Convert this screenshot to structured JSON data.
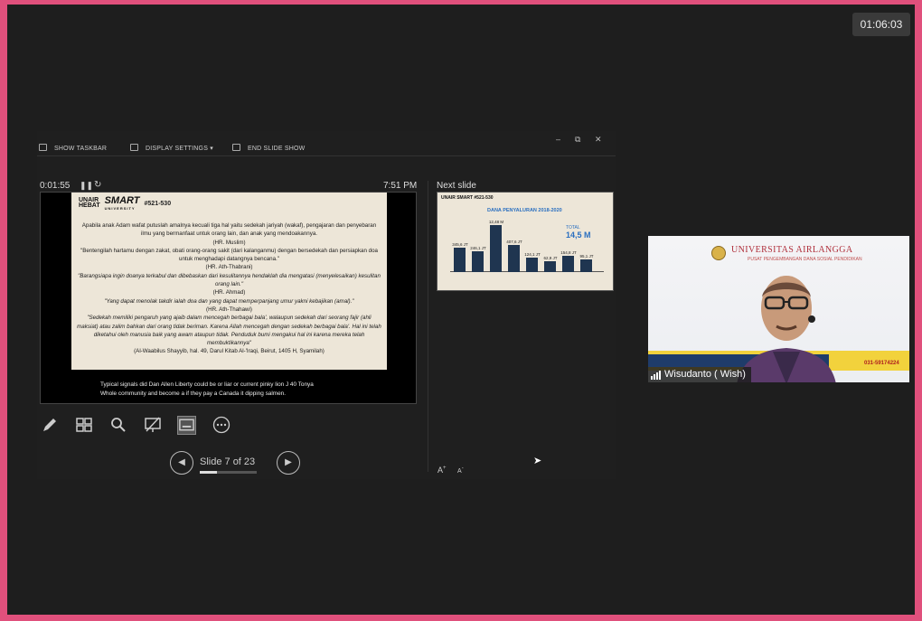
{
  "meeting": {
    "timer": "01:06:03"
  },
  "window_controls": {
    "minimize": "–",
    "restore": "⧉",
    "close": "✕"
  },
  "toolbar": {
    "show_taskbar": "SHOW TASKBAR",
    "display_settings": "DISPLAY SETTINGS ▾",
    "end_slide_show": "END SLIDE SHOW"
  },
  "presenter": {
    "elapsed": "0:01:55",
    "pause_icon": "pause-icon",
    "restart_icon": "restart-icon",
    "clock": "7:51 PM",
    "slide_counter": "Slide 7 of 23",
    "progress_fraction": 0.304,
    "next_slide_label": "Next slide",
    "font_increase": "A",
    "font_decrease": "A",
    "prev_icon": "chevron-left-icon",
    "next_icon": "chevron-right-icon"
  },
  "current_slide": {
    "logo_unair": "UNAIR",
    "logo_hebat": "HEBAT",
    "logo_smart": "SMART",
    "logo_university": "UNIVERSITY",
    "logo_number": "#521-530",
    "lines": [
      "Apabila anak Adam wafat putuslah amalnya kecuali tiga hal yaitu sedekah jariyah (wakaf), pengajaran dan penyebaran ilmu yang bermanfaat untuk orang lain, dan anak  yang mendoakannya.",
      "(HR. Muslim)",
      "\"Bentengilah hartamu dengan zakat, obati orang-orang sakit (dari kalanganmu) dengan bersedekah dan persiapkan doa untuk menghadapi datangnya bencana.\"",
      "(HR. Ath-Thabrani)",
      "\"Barangsiapa ingin doanya terkabul dan dibebaskan dari kesulitannya hendaklah dia mengatasi (menyelesaikan) kesulitan orang lain.\"",
      "(HR. Ahmad)",
      "\"Yang dapat menolak takdir ialah doa dan yang dapat memperpanjang umur yakni kebajikan (amal).\"",
      "(HR. Ath-Thahawi)",
      "\"Sedekah memiliki pengaruh yang ajaib dalam mencegah berbagai bala', walaupun sedekah dari seorang fajir (ahli maksiat) atau zalim bahkan dari orang tidak beriman. Karena Allah mencegah dengan sedekah berbagai bala'. Hal ini telah diketahui oleh manusia baik yang awam ataupun tidak. Penduduk bumi mengakui hal ini karena mereka telah membuktikannya\"",
      "(Al-Waabilus Shayyib, hal. 49, Darul Kitab Al-'Iraqi, Beirut, 1405 H, Syamilah)"
    ]
  },
  "captions": {
    "line1": "Typical signals did Dan Allen Liberty could be or liar or current pinky lion J 40 Tonya",
    "line2": "Whole community and become a if they pay a Canada it dipping salmen."
  },
  "next_slide": {
    "logo": "UNAIR SMART #521-530",
    "title": "DANA PENYALURAN 2018-2020",
    "total_label": "TOTAL",
    "total_value": "14,5 M",
    "bars": [
      {
        "value": "345,6 JT",
        "num": 345.6
      },
      {
        "value": "246,1 JT",
        "num": 246.1
      },
      {
        "value": "12,48 M",
        "num": 1248
      },
      {
        "value": "407,6 JT",
        "num": 407.6
      },
      {
        "value": "124,1 JT",
        "num": 124.1
      },
      {
        "value": "62,9 JT",
        "num": 62.9
      },
      {
        "value": "154,8 JT",
        "num": 154.8
      },
      {
        "value": "95,1 JT",
        "num": 95.1
      }
    ]
  },
  "video": {
    "header": "UNIVERSITAS AIRLANGGA",
    "subheader": "PUSAT PENGEMBANGAN DANA SOSIAL PENDIDIKAN",
    "phone": "031-59174224",
    "participant_name": "Wisudanto ( Wish)",
    "signal_icon": "signal-bars-icon"
  },
  "colors": {
    "frame": "#e0507c",
    "background": "#1e1e1e",
    "accent_blue": "#2a6fc0",
    "bar_navy": "#1f3550"
  }
}
